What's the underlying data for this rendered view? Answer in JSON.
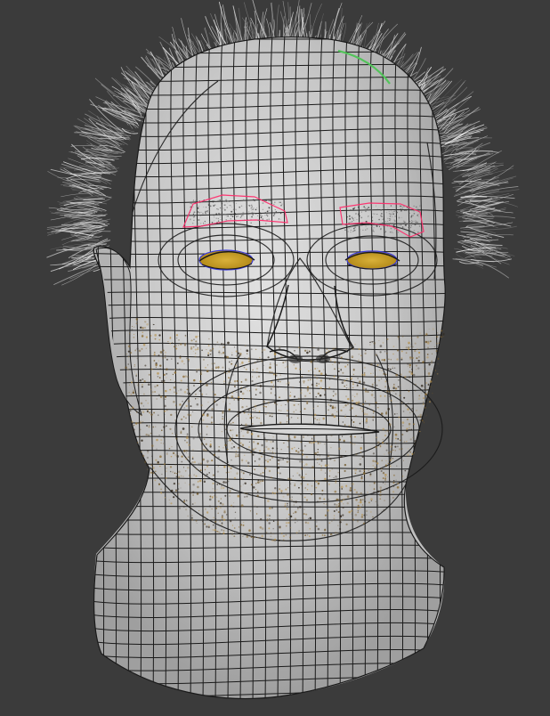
{
  "viewport": {
    "background": "#3b3b3b",
    "model": {
      "shading": "#c9c9c9",
      "wire_color": "#1a1a1a",
      "hair_color": "#b8b8b8",
      "beard_color": "#8a6a32",
      "eye_color": "#c9a227",
      "eyebrow_selection_color": "#ff2f6d",
      "accent_green": "#52c45a"
    }
  }
}
